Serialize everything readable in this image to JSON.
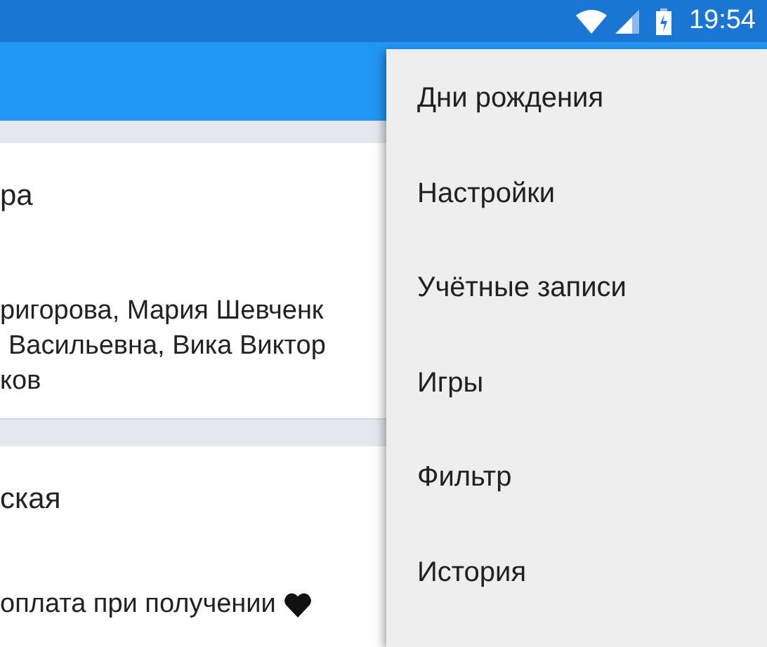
{
  "status_bar": {
    "time": "19:54"
  },
  "cards": [
    {
      "title": "ра",
      "lines": [
        "ригорова, Мария Шевченк",
        "Васильевна, Вика Виктор",
        "ков"
      ]
    },
    {
      "title": "ская",
      "lines": [
        "оплата при получении"
      ]
    }
  ],
  "menu": {
    "items": [
      {
        "label": "Дни рождения"
      },
      {
        "label": "Настройки"
      },
      {
        "label": "Учётные записи"
      },
      {
        "label": "Игры"
      },
      {
        "label": "Фильтр"
      },
      {
        "label": "История"
      }
    ]
  }
}
